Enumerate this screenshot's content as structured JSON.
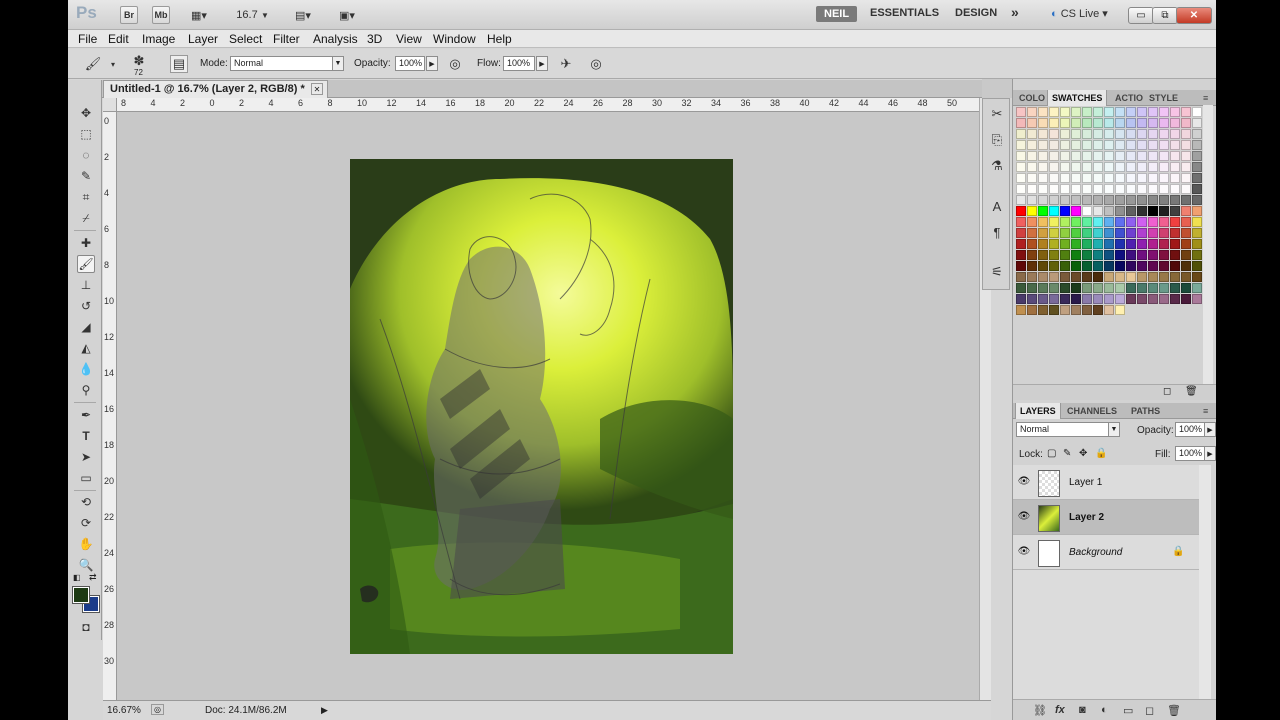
{
  "titlebar": {
    "app_logo": "Ps",
    "bridge": "Br",
    "mini_bridge": "Mb",
    "zoom_value": "16.7",
    "workspaces": [
      "NEIL",
      "ESSENTIALS",
      "DESIGN"
    ],
    "more": "»",
    "cs_live": "CS Live",
    "minimize": "▭",
    "maximize": "⧉",
    "close": "✕"
  },
  "menu": [
    "File",
    "Edit",
    "Image",
    "Layer",
    "Select",
    "Filter",
    "Analysis",
    "3D",
    "View",
    "Window",
    "Help"
  ],
  "options": {
    "brush_size": "72",
    "mode_label": "Mode:",
    "mode_value": "Normal",
    "opacity_label": "Opacity:",
    "opacity_value": "100%",
    "flow_label": "Flow:",
    "flow_value": "100%"
  },
  "document": {
    "tab_title": "Untitled-1 @ 16.7% (Layer 2, RGB/8) *",
    "close": "✕",
    "ruler_h": [
      "0",
      "2",
      "4",
      "6",
      "8",
      "10",
      "12",
      "14",
      "0",
      "2",
      "4",
      "6",
      "8",
      "10",
      "12",
      "14",
      "16",
      "18",
      "20",
      "22",
      "24",
      "26",
      "28",
      "30",
      "32",
      "34",
      "36",
      "38",
      "40",
      "42",
      "44",
      "46",
      "48",
      "50"
    ],
    "ruler_h_shown": [
      "8",
      "4",
      "2",
      "0",
      "2",
      "4",
      "6",
      "8",
      "10",
      "12",
      "14",
      "16",
      "18",
      "20",
      "22",
      "24",
      "26",
      "28",
      "30",
      "32",
      "34",
      "36",
      "38",
      "40",
      "42",
      "44",
      "46",
      "48",
      "50"
    ],
    "ruler_v": [
      "0",
      "2",
      "4",
      "6",
      "8",
      "10",
      "12",
      "14",
      "16",
      "18",
      "20",
      "22",
      "24",
      "26",
      "28",
      "30"
    ],
    "zoom_status": "16.67%",
    "doc_info": "Doc: 24.1M/86.2M"
  },
  "panels": {
    "swatches_tabs": [
      "COLO",
      "SWATCHES",
      "ACTIO",
      "STYLE"
    ],
    "swatches_active": "SWATCHES",
    "layers_tabs": [
      "LAYERS",
      "CHANNELS",
      "PATHS"
    ],
    "blend_mode": "Normal",
    "opacity_label": "Opacity:",
    "opacity_value": "100%",
    "lock_label": "Lock:",
    "fill_label": "Fill:",
    "fill_value": "100%",
    "layers": [
      {
        "name": "Layer 1",
        "selected": false,
        "visible": true
      },
      {
        "name": "Layer 2",
        "selected": true,
        "visible": true
      },
      {
        "name": "Background",
        "selected": false,
        "visible": true,
        "locked": true
      }
    ]
  },
  "colors": {
    "foreground": "#1d3a13",
    "background": "#1b3c8a",
    "swatches": [
      "#f7c4c4",
      "#f9d4c0",
      "#fbe3c2",
      "#fdf3c3",
      "#f3f8c4",
      "#ddf3c4",
      "#c7efc8",
      "#c4efd9",
      "#c4efef",
      "#c4e0f5",
      "#c4cff7",
      "#cfc4f7",
      "#e0c4f7",
      "#f1c4f5",
      "#f7c4e5",
      "#f7c4d3",
      "#ffffff",
      "#f0f0f0",
      "#f3b9b9",
      "#f6cab3",
      "#f9dcb5",
      "#fcefb7",
      "#ecf5b8",
      "#d1eeb8",
      "#b8e9bd",
      "#b8e9d2",
      "#b8e9e9",
      "#b8d6ef",
      "#b8c3f1",
      "#c3b8f1",
      "#d6b8f1",
      "#eab8ef",
      "#f1b8dd",
      "#f1b8c9",
      "#e8e8e8",
      "#dcdcdc",
      "#efeecd",
      "#f1ead2",
      "#f3e7d6",
      "#f4e4d9",
      "#ecefd8",
      "#e0efd8",
      "#d7ecdb",
      "#d6ece4",
      "#d6ecec",
      "#d6e5f0",
      "#d6dcf1",
      "#dcd6f1",
      "#e5d6f1",
      "#eed6ef",
      "#f1d6e8",
      "#f1d6de",
      "#d0d0d0",
      "#c4c4c4",
      "#f6f4dc",
      "#f5efdd",
      "#f3ecdf",
      "#f1eae1",
      "#ecf0e0",
      "#e4f0e0",
      "#def0e3",
      "#def0ea",
      "#def0f0",
      "#dee9f2",
      "#dee2f3",
      "#e2def3",
      "#e9def3",
      "#f0def2",
      "#f3dee9",
      "#f3dee3",
      "#b8b8b8",
      "#acacac",
      "#f9f8e6",
      "#f7f4e6",
      "#f6f2e7",
      "#f4f0e8",
      "#f0f3e8",
      "#eaf3e8",
      "#e6f3ea",
      "#e6f3ef",
      "#e6f3f3",
      "#e6eef5",
      "#e6e9f6",
      "#e9e6f6",
      "#eee6f6",
      "#f3e6f5",
      "#f6e6ee",
      "#f6e6ea",
      "#a0a0a0",
      "#949494",
      "#fbfaee",
      "#faf8ee",
      "#f9f6ef",
      "#f7f4ef",
      "#f4f7ef",
      "#f0f7ef",
      "#edf7f0",
      "#edf7f4",
      "#edf7f7",
      "#edf3f8",
      "#edeff9",
      "#efedf9",
      "#f3edf9",
      "#f7edf8",
      "#f9edf3",
      "#f9edf0",
      "#888888",
      "#7c7c7c",
      "#fdfdf6",
      "#fcfbf6",
      "#fbfaf7",
      "#faf9f7",
      "#f9fbf7",
      "#f7fbf7",
      "#f5fbf7",
      "#f5fbf9",
      "#f5fbfb",
      "#f5f9fc",
      "#f5f6fc",
      "#f6f5fc",
      "#f9f5fc",
      "#fbf5fc",
      "#fcf5f9",
      "#fcf5f7",
      "#707070",
      "#646464",
      "#fefefb",
      "#fefdfb",
      "#fdfdfb",
      "#fdfcfb",
      "#fcfdfb",
      "#fbfdfb",
      "#fafdfb",
      "#fafdfc",
      "#fafdfd",
      "#fafcfd",
      "#fafbfd",
      "#fbfafd",
      "#fcfafd",
      "#fdfafd",
      "#fdfafc",
      "#fdfafb",
      "#585858",
      "#4c4c4c",
      "#e8e8e8",
      "#e0e0e0",
      "#d8d8d8",
      "#d0d0d0",
      "#c8c8c8",
      "#c0c0c0",
      "#b8b8b8",
      "#b0b0b0",
      "#a8a8a8",
      "#a0a0a0",
      "#989898",
      "#909090",
      "#888888",
      "#808080",
      "#787878",
      "#707070",
      "#686868",
      "#606060",
      "#ff0000",
      "#ffff00",
      "#00ff00",
      "#00ffff",
      "#0000ff",
      "#ff00ff",
      "#ffffff",
      "#e8e8e8",
      "#c0c0c0",
      "#909090",
      "#606060",
      "#303030",
      "#000000",
      "#202020",
      "#404040",
      "#f08070",
      "#f0a070",
      "#f0d070",
      "#f06060",
      "#f09060",
      "#f0c060",
      "#f0f060",
      "#b0f060",
      "#70f060",
      "#60f0a0",
      "#60f0f0",
      "#60b0f0",
      "#6070f0",
      "#9060f0",
      "#d060f0",
      "#f060d0",
      "#f06090",
      "#f04040",
      "#e86050",
      "#f0e050",
      "#d0e050",
      "#d04040",
      "#d07040",
      "#d0a040",
      "#d0d040",
      "#90d040",
      "#50d040",
      "#40d080",
      "#40d0d0",
      "#4090d0",
      "#4050d0",
      "#7040d0",
      "#b040d0",
      "#d040b0",
      "#d04070",
      "#c03030",
      "#c05030",
      "#c0b030",
      "#a0c030",
      "#b02020",
      "#b05020",
      "#b08020",
      "#b0b020",
      "#70b020",
      "#30b020",
      "#20b060",
      "#20b0b0",
      "#2070b0",
      "#2030b0",
      "#5020b0",
      "#9020b0",
      "#b02090",
      "#b02050",
      "#a01818",
      "#a04018",
      "#a09018",
      "#80a018",
      "#801010",
      "#804010",
      "#806010",
      "#808010",
      "#508010",
      "#108010",
      "#108040",
      "#108080",
      "#105080",
      "#101080",
      "#401080",
      "#701080",
      "#801070",
      "#801040",
      "#701010",
      "#704010",
      "#707010",
      "#507010",
      "#600808",
      "#603008",
      "#604808",
      "#606008",
      "#386008",
      "#086008",
      "#086030",
      "#086060",
      "#083860",
      "#080860",
      "#300860",
      "#500860",
      "#600850",
      "#600830",
      "#500808",
      "#503008",
      "#505008",
      "#385008",
      "#8a6a4a",
      "#9a7a5a",
      "#aa8a6a",
      "#ba9a7a",
      "#7a5a3a",
      "#6a4a2a",
      "#5a3a1a",
      "#4a2a0a",
      "#c8a878",
      "#d8b888",
      "#e8c898",
      "#b89868",
      "#a88858",
      "#987848",
      "#886838",
      "#785828",
      "#684818",
      "#584008",
      "#3a5a3a",
      "#4a6a4a",
      "#5a7a5a",
      "#6a8a6a",
      "#2a4a2a",
      "#1a3a1a",
      "#7a9a7a",
      "#8aaa8a",
      "#9aba9a",
      "#aacaaa",
      "#3a6a5a",
      "#4a7a6a",
      "#5a8a7a",
      "#6a9a8a",
      "#2a5a4a",
      "#1a4a3a",
      "#7aaa9a",
      "#8abaaa",
      "#4a3a6a",
      "#5a4a7a",
      "#6a5a8a",
      "#7a6a9a",
      "#3a2a5a",
      "#2a1a4a",
      "#8a7aaa",
      "#9a8aba",
      "#aa9aca",
      "#bbaada",
      "#6a3a5a",
      "#7a4a6a",
      "#8a5a7a",
      "#9a6a8a",
      "#5a2a4a",
      "#4a1a3a",
      "#aa7a9a",
      "#ba8aaa",
      "#c09050",
      "#a07040",
      "#806030",
      "#605020",
      "#c0a080",
      "#a08060",
      "#806040",
      "#604020",
      "#e0c0a0",
      "#fff0b0"
    ]
  }
}
